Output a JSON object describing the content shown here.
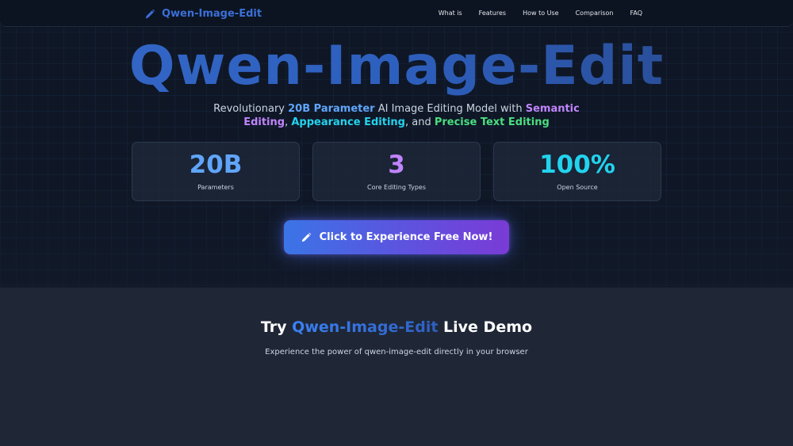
{
  "nav": {
    "brand": "Qwen-Image-Edit",
    "brand_icon": "pencil-icon",
    "links": [
      "What is",
      "Features",
      "How to Use",
      "Comparison",
      "FAQ"
    ]
  },
  "hero": {
    "title": "Qwen-Image-Edit",
    "subtitle": {
      "t1": "Revolutionary ",
      "h1": "20B Parameter",
      "t2": " AI Image Editing Model with ",
      "h2": "Semantic Editing",
      "t3": ", ",
      "h3": "Appearance Editing",
      "t4": ", and ",
      "h4": "Precise Text Editing"
    },
    "stats": [
      {
        "value": "20B",
        "label": "Parameters",
        "color": "#60a5fa"
      },
      {
        "value": "3",
        "label": "Core Editing Types",
        "color": "#c084fc"
      },
      {
        "value": "100%",
        "label": "Open Source",
        "color": "#22d3ee"
      }
    ],
    "cta": {
      "label": "Click to Experience Free Now!",
      "icon": "pencil-icon"
    }
  },
  "demo": {
    "title_prefix": "Try ",
    "title_accent": "Qwen-Image-Edit",
    "title_suffix": " Live Demo",
    "subtitle": "Experience the power of qwen-image-edit directly in your browser"
  },
  "colors": {
    "background": "#0f1726",
    "section_background": "#1f2737",
    "brand_blue": "#3b6fd6",
    "cta_gradient_start": "#3b74e6",
    "cta_gradient_end": "#7a3bd6"
  }
}
